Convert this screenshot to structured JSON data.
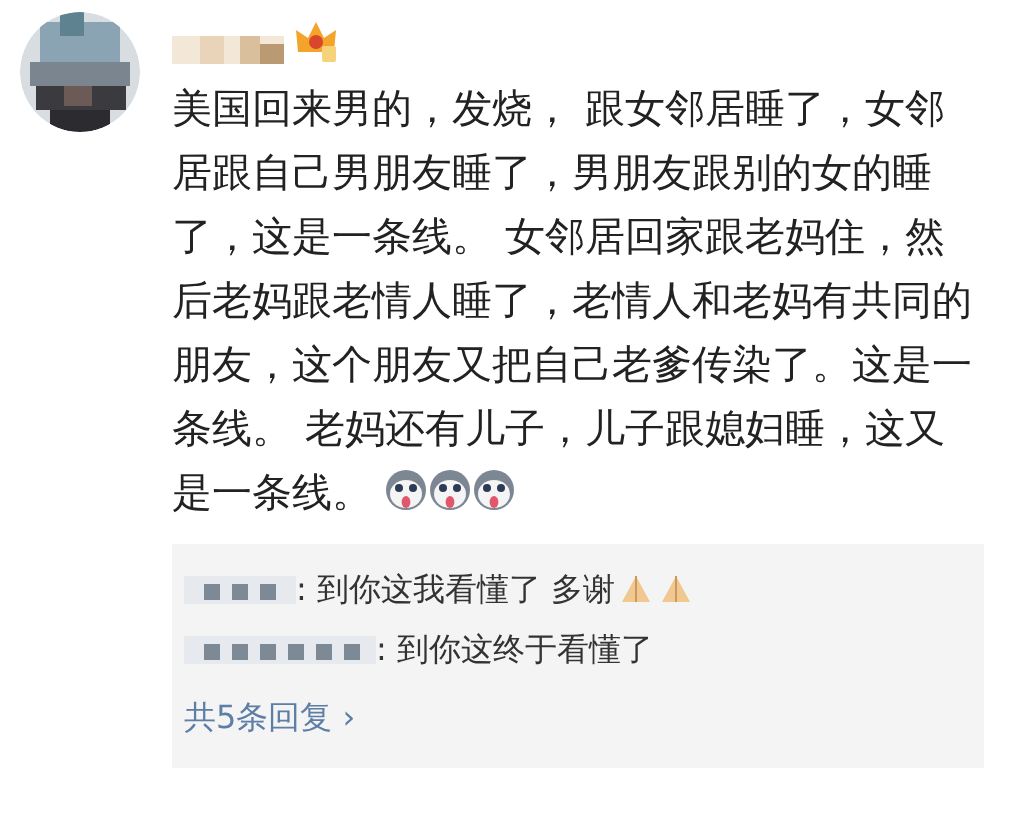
{
  "comment": {
    "text": "美国回来男的，发烧， 跟女邻居睡了，女邻居跟自己男朋友睡了，男朋友跟别的女的睡了，这是一条线。 女邻居回家跟老妈住，然后老妈跟老情人睡了，老情人和老妈有共同的朋友，这个朋友又把自己老爹传染了。这是一条线。 老妈还有儿子，儿子跟媳妇睡，这又是一条线。"
  },
  "replies": [
    {
      "text": ": 到你这我看懂了 多谢"
    },
    {
      "text": ": 到你这终于看懂了"
    }
  ],
  "more_replies": {
    "label": "共5条回复",
    "arrow": "›"
  }
}
